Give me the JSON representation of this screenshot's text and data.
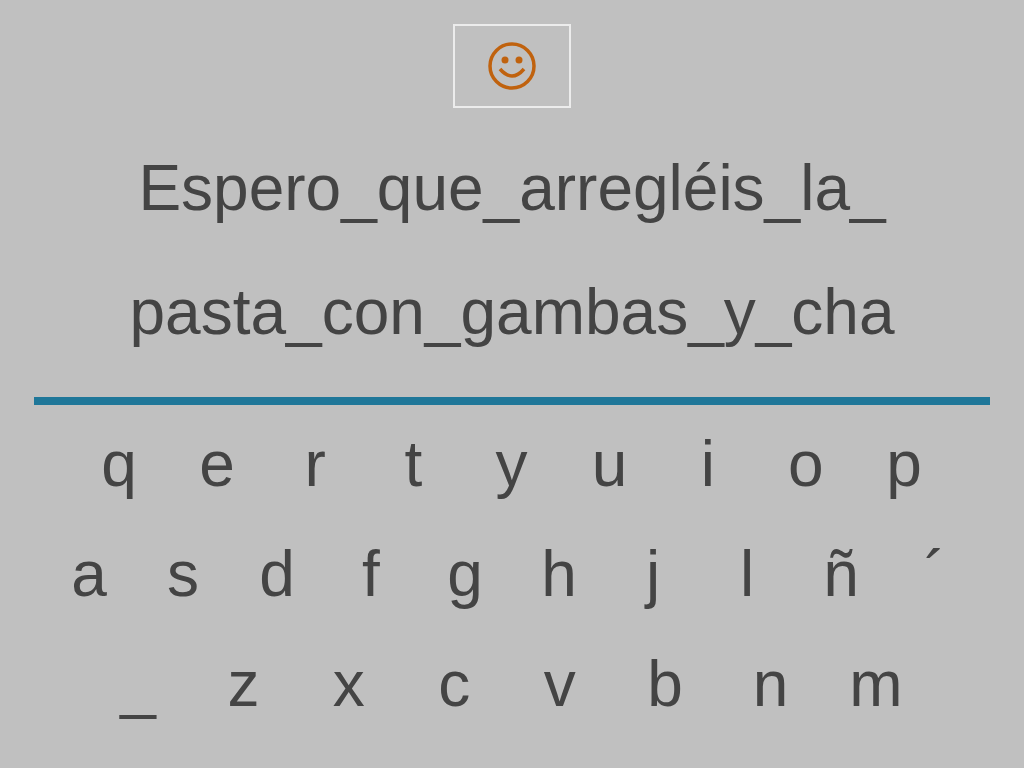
{
  "sentence_lines": [
    "Espero_que_arregléis_la_",
    "pasta_con_gambas_y_cha"
  ],
  "keyboard_rows": [
    [
      "q",
      "e",
      "r",
      "t",
      "y",
      "u",
      "i",
      "o",
      "p"
    ],
    [
      "a",
      "s",
      "d",
      "f",
      "g",
      "h",
      "j",
      "l",
      "ñ",
      "´"
    ],
    [
      "_",
      "z",
      "x",
      "c",
      "v",
      "b",
      "n",
      "m"
    ]
  ]
}
